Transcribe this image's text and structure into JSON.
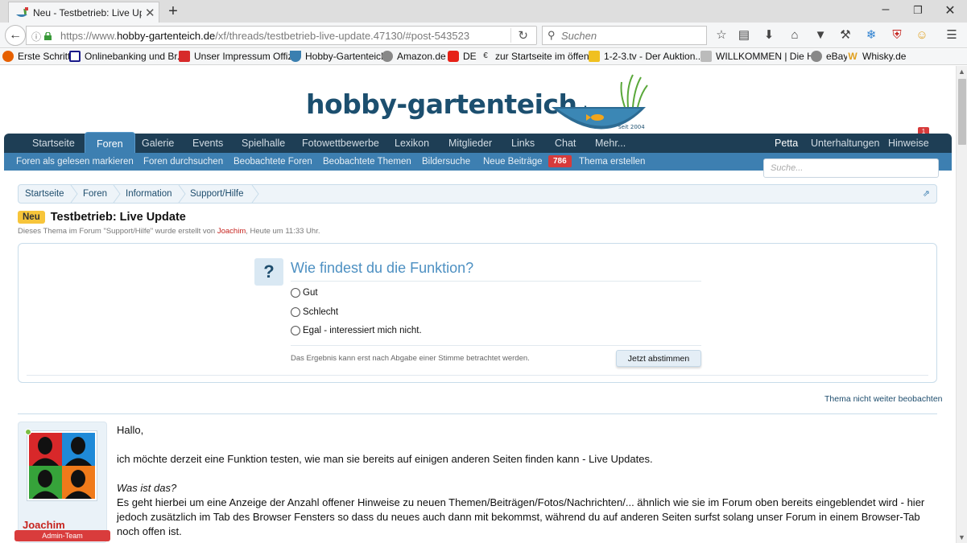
{
  "browser": {
    "tab_title": "Neu - Testbetrieb: Live Up...",
    "tab_close": "✕",
    "new_tab": "+",
    "win_minimize": "–",
    "win_restore": "❐",
    "win_close": "✕",
    "url_prefix": "https://www.",
    "url_domain": "hobby-gartenteich.de",
    "url_path": "/xf/threads/testbetrieb-live-update.47130/#post-543523",
    "search_placeholder": "Suchen",
    "bookmarks": [
      "Erste Schritte",
      "Onlinebanking und Br...",
      "Unser Impressum Offiz...",
      "Hobby-Gartenteich",
      "Amazon.de",
      "DE",
      "zur Startseite im öffent...",
      "1-2-3.tv - Der Auktion...",
      "WILLKOMMEN | Die H...",
      "eBay",
      "Whisky.de"
    ]
  },
  "site": {
    "logo_text": "hobby-gartenteich",
    "logo_tld": ".de",
    "logo_since": "seit 2004",
    "main_nav": [
      "Startseite",
      "Foren",
      "Galerie",
      "Events",
      "Spielhalle",
      "Fotowettbewerbe",
      "Lexikon",
      "Mitglieder",
      "Links",
      "Chat",
      "Mehr..."
    ],
    "active_nav": "Foren",
    "user_nav": [
      "Petta",
      "Unterhaltungen",
      "Hinweise"
    ],
    "notification_count": "1",
    "sub_nav": [
      "Foren als gelesen markieren",
      "Foren durchsuchen",
      "Beobachtete Foren",
      "Beobachtete Themen",
      "Bildersuche",
      "Neue Beiträge",
      "Thema erstellen"
    ],
    "new_posts_count": "786",
    "search_placeholder": "Suche...",
    "breadcrumb": [
      "Startseite",
      "Foren",
      "Information",
      "Support/Hilfe"
    ]
  },
  "thread": {
    "badge": "Neu",
    "title": "Testbetrieb: Live Update",
    "desc_prefix": "Dieses Thema im Forum \"Support/Hilfe\" wurde erstellt von ",
    "desc_author": "Joachim",
    "desc_suffix": ", Heute um 11:33 Uhr.",
    "unwatch": "Thema nicht weiter beobachten"
  },
  "poll": {
    "icon": "?",
    "question": "Wie findest du die Funktion?",
    "options": [
      "Gut",
      "Schlecht",
      "Egal - interessiert mich nicht."
    ],
    "note": "Das Ergebnis kann erst nach Abgabe einer Stimme betrachtet werden.",
    "vote_button": "Jetzt abstimmen"
  },
  "post": {
    "author": "Joachim",
    "author_title": "Admin-Team",
    "greeting": "Hallo,",
    "line1": "ich möchte derzeit eine Funktion testen, wie man sie bereits auf einigen anderen Seiten finden kann - Live Updates.",
    "subheading": "Was ist das?",
    "line2": "Es geht hierbei um eine Anzeige der Anzahl offener Hinweise zu neuen Themen/Beiträgen/Fotos/Nachrichten/... ähnlich wie sie im Forum oben bereits eingeblendet wird - hier jedoch zusätzlich im Tab des Browser Fensters so dass du neues auch dann mit bekommst, während du auf anderen Seiten surfst solang unser Forum in einem Browser-Tab noch offen ist."
  },
  "colors": {
    "nav_dark": "#1e3e55",
    "nav_blue": "#3d7fb1",
    "accent_red": "#c6231e",
    "badge_yellow": "#f7c53a",
    "poll_question": "#4d90c2"
  }
}
